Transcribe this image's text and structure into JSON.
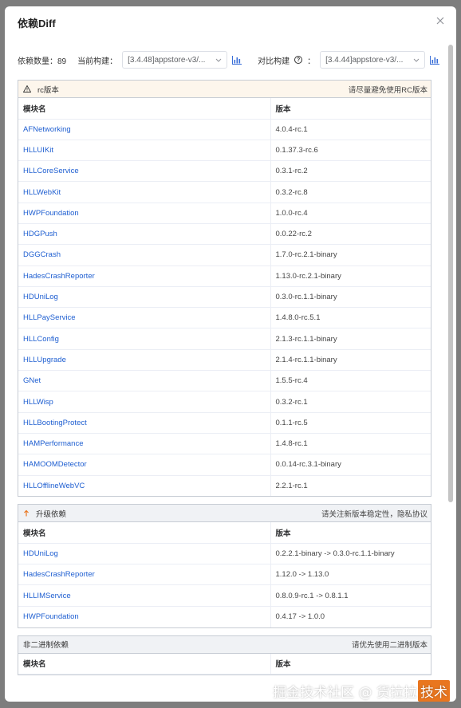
{
  "dialog": {
    "title": "依赖Diff"
  },
  "toolbar": {
    "count_label": "依赖数量：",
    "count_value": "89",
    "current_label": "当前构建：",
    "current_value": "[3.4.48]appstore-v3/...",
    "compare_label": "对比构建",
    "help_glyph": "?",
    "compare_colon": "：",
    "compare_value": "[3.4.44]appstore-v3/..."
  },
  "sections": {
    "rc": {
      "title": "rc版本",
      "hint": "请尽量避免使用RC版本",
      "col_module": "模块名",
      "col_version": "版本",
      "rows": [
        {
          "module": "AFNetworking",
          "version": "4.0.4-rc.1"
        },
        {
          "module": "HLLUIKit",
          "version": "0.1.37.3-rc.6"
        },
        {
          "module": "HLLCoreService",
          "version": "0.3.1-rc.2"
        },
        {
          "module": "HLLWebKit",
          "version": "0.3.2-rc.8"
        },
        {
          "module": "HWPFoundation",
          "version": "1.0.0-rc.4"
        },
        {
          "module": "HDGPush",
          "version": "0.0.22-rc.2"
        },
        {
          "module": "DGGCrash",
          "version": "1.7.0-rc.2.1-binary"
        },
        {
          "module": "HadesCrashReporter",
          "version": "1.13.0-rc.2.1-binary"
        },
        {
          "module": "HDUniLog",
          "version": "0.3.0-rc.1.1-binary"
        },
        {
          "module": "HLLPayService",
          "version": "1.4.8.0-rc.5.1"
        },
        {
          "module": "HLLConfig",
          "version": "2.1.3-rc.1.1-binary"
        },
        {
          "module": "HLLUpgrade",
          "version": "2.1.4-rc.1.1-binary"
        },
        {
          "module": "GNet",
          "version": "1.5.5-rc.4"
        },
        {
          "module": "HLLWisp",
          "version": "0.3.2-rc.1"
        },
        {
          "module": "HLLBootingProtect",
          "version": "0.1.1-rc.5"
        },
        {
          "module": "HAMPerformance",
          "version": "1.4.8-rc.1"
        },
        {
          "module": "HAMOOMDetector",
          "version": "0.0.14-rc.3.1-binary"
        },
        {
          "module": "HLLOfflineWebVC",
          "version": "2.2.1-rc.1"
        }
      ]
    },
    "upgrade": {
      "title": "升级依赖",
      "hint": "请关注新版本稳定性，隐私协议",
      "col_module": "模块名",
      "col_version": "版本",
      "rows": [
        {
          "module": "HDUniLog",
          "version": "0.2.2.1-binary -> 0.3.0-rc.1.1-binary"
        },
        {
          "module": "HadesCrashReporter",
          "version": "1.12.0 -> 1.13.0"
        },
        {
          "module": "HLLIMService",
          "version": "0.8.0.9-rc.1 -> 0.8.1.1"
        },
        {
          "module": "HWPFoundation",
          "version": "0.4.17 -> 1.0.0"
        }
      ]
    },
    "nonbinary": {
      "title": "非二进制依赖",
      "hint": "请优先使用二进制版本",
      "col_module": "模块名",
      "col_version": "版本"
    }
  },
  "watermark": {
    "text": "掘金技术社区 @ 货拉拉",
    "tag": "技术"
  },
  "colors": {
    "link": "#1f5fd1",
    "warn_bg": "#fdf6ec",
    "accent": "#e9761f",
    "chart_icon": "#3a6fd8"
  }
}
